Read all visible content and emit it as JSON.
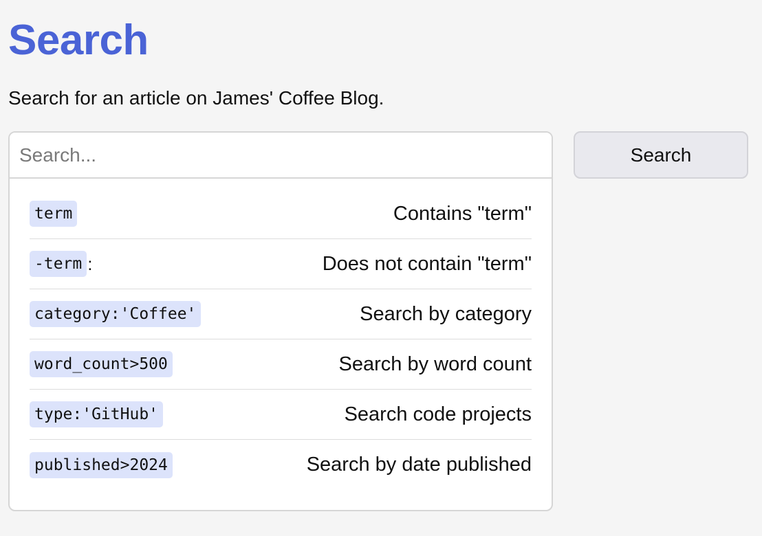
{
  "header": {
    "title": "Search",
    "subtitle": "Search for an article on James' Coffee Blog."
  },
  "search": {
    "placeholder": "Search...",
    "value": "",
    "button_label": "Search"
  },
  "hints": [
    {
      "code": "term",
      "suffix": "",
      "description": "Contains \"term\""
    },
    {
      "code": "-term",
      "suffix": ":",
      "description": "Does not contain \"term\""
    },
    {
      "code": "category:'Coffee'",
      "suffix": "",
      "description": "Search by category"
    },
    {
      "code": "word_count>500",
      "suffix": "",
      "description": "Search by word count"
    },
    {
      "code": "type:'GitHub'",
      "suffix": "",
      "description": "Search code projects"
    },
    {
      "code": "published>2024",
      "suffix": "",
      "description": "Search by date published"
    }
  ],
  "colors": {
    "accent": "#4a63d6",
    "code_background": "#dce3fb",
    "page_background": "#f5f5f5"
  }
}
